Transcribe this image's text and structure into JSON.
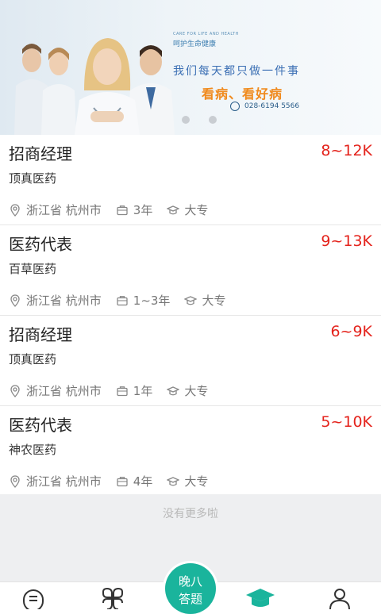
{
  "banner": {
    "small_caption": "CARE FOR LIFE AND HEALTH",
    "brand": "呵护生命健康",
    "slogan": "我们每天都只做一件事",
    "slogan_highlight": "看病、看好病",
    "phone": "028-6194 5566",
    "page_dots": 2
  },
  "jobs": [
    {
      "title": "招商经理",
      "salary": "8~12K",
      "company": "顶真医药",
      "location": "浙江省 杭州市",
      "experience": "3年",
      "education": "大专"
    },
    {
      "title": "医药代表",
      "salary": "9~13K",
      "company": "百草医药",
      "location": "浙江省 杭州市",
      "experience": "1~3年",
      "education": "大专"
    },
    {
      "title": "招商经理",
      "salary": "6~9K",
      "company": "顶真医药",
      "location": "浙江省 杭州市",
      "experience": "1年",
      "education": "大专"
    },
    {
      "title": "医药代表",
      "salary": "5~10K",
      "company": "神农医药",
      "location": "浙江省 杭州市",
      "experience": "4年",
      "education": "大专"
    }
  ],
  "list_end_text": "没有更多啦",
  "tabbar": {
    "center_line1": "晚八",
    "center_line2": "答题",
    "accent_color": "#1ab49c",
    "salary_color": "#e4231c",
    "icons": [
      "document-icon",
      "grid-icon",
      "graduation-cap-icon",
      "user-icon"
    ]
  }
}
